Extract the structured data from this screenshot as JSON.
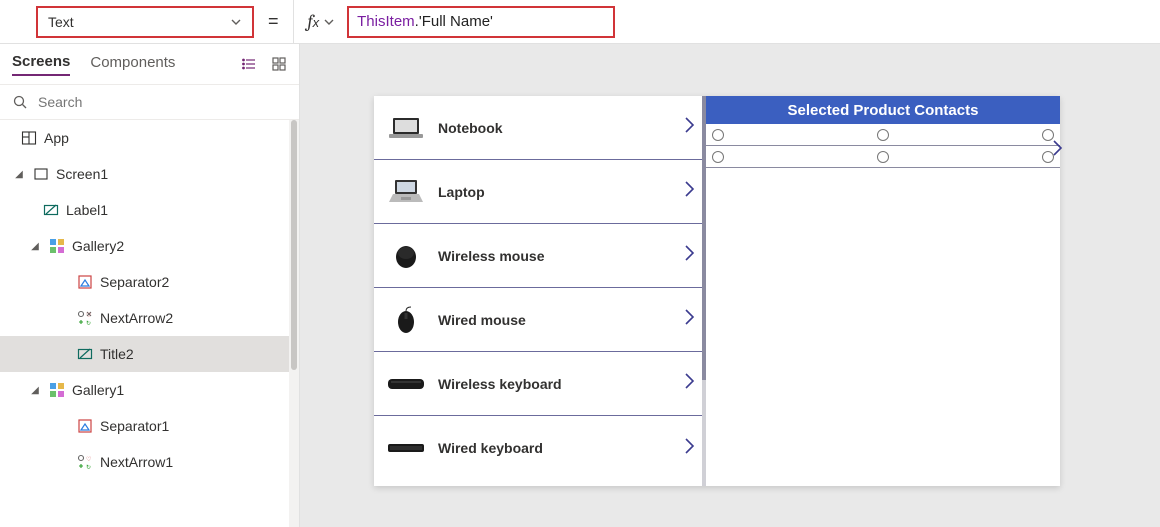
{
  "formula_bar": {
    "property_name": "Text",
    "formula_obj": "ThisItem",
    "formula_rest": ".'Full Name'"
  },
  "left_panel": {
    "tabs": {
      "screens": "Screens",
      "components": "Components"
    },
    "search_placeholder": "Search",
    "tree": {
      "app": "App",
      "screen1": "Screen1",
      "label1": "Label1",
      "gallery2": "Gallery2",
      "separator2": "Separator2",
      "nextarrow2": "NextArrow2",
      "title2": "Title2",
      "gallery1": "Gallery1",
      "separator1": "Separator1",
      "nextarrow1": "NextArrow1"
    }
  },
  "canvas": {
    "header_label": "Selected Product Contacts",
    "products": {
      "p0": "Notebook",
      "p1": "Laptop",
      "p2": "Wireless mouse",
      "p3": "Wired mouse",
      "p4": "Wireless keyboard",
      "p5": "Wired keyboard"
    }
  }
}
